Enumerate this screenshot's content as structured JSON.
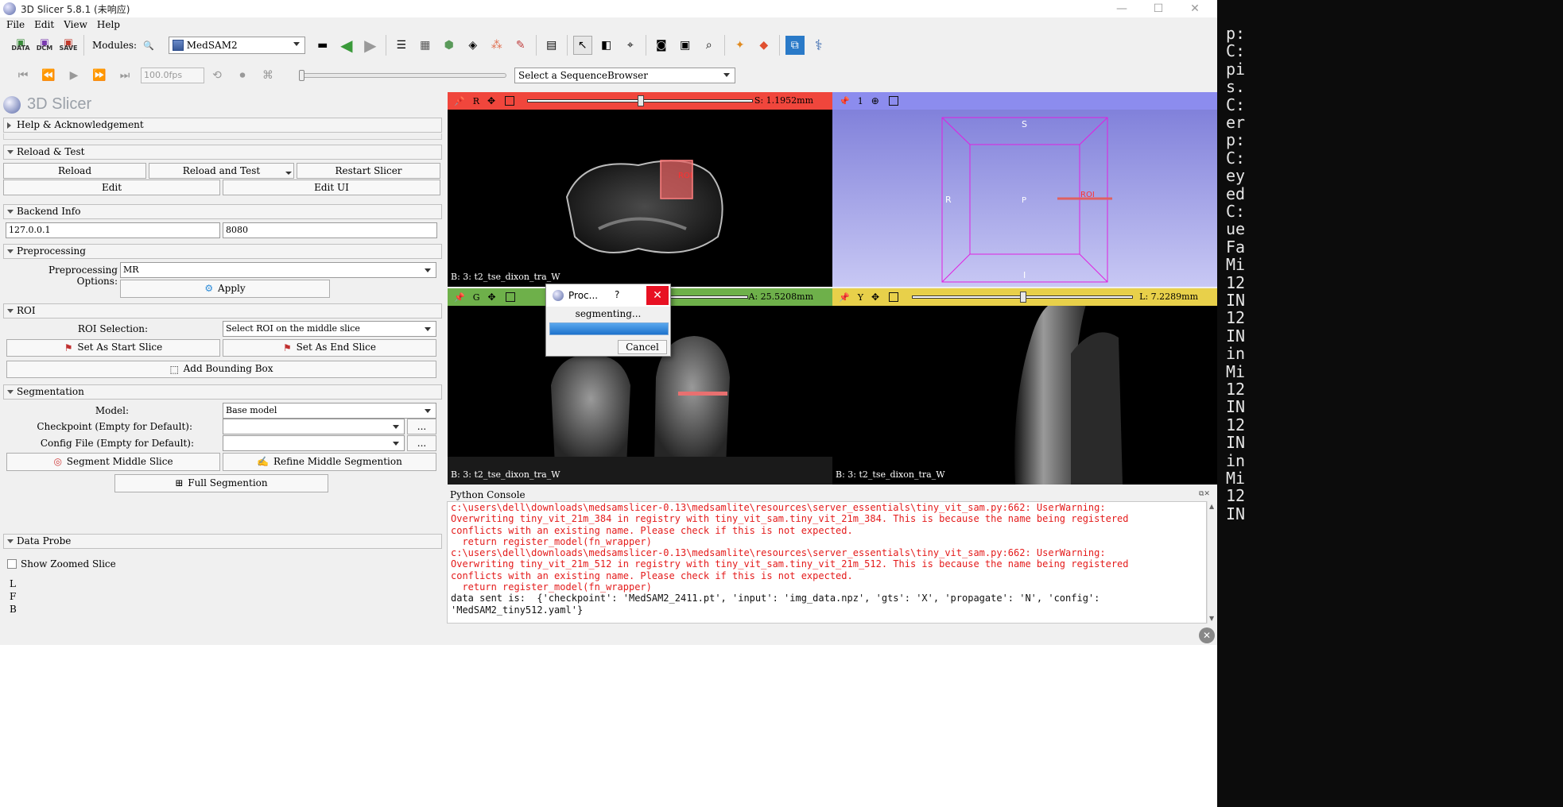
{
  "window": {
    "title": "3D Slicer 5.8.1 (未响应)"
  },
  "menu": [
    "File",
    "Edit",
    "View",
    "Help"
  ],
  "toolbar": {
    "data_label": "DATA",
    "dcm_label": "DCM",
    "save_label": "SAVE",
    "modules_label": "Modules:",
    "module_selected": "MedSAM2"
  },
  "playback": {
    "fps": "100.0fps",
    "sequence_browser": "Select a SequenceBrowser"
  },
  "left_panel": {
    "logo_text": "3D Slicer",
    "help_header": "Help & Acknowledgement",
    "reload_header": "Reload & Test",
    "reload_btn": "Reload",
    "reload_test_btn": "Reload and Test",
    "restart_btn": "Restart Slicer",
    "edit_btn": "Edit",
    "edit_ui_btn": "Edit UI",
    "backend_header": "Backend Info",
    "backend_host": "127.0.0.1",
    "backend_port": "8080",
    "preprocessing_header": "Preprocessing",
    "preprocessing_label": "Preprocessing Options:",
    "preprocessing_value": "MR",
    "apply_btn": "Apply",
    "roi_header": "ROI",
    "roi_selection_label": "ROI Selection:",
    "roi_selection_value": "Select ROI on the middle slice",
    "start_slice_btn": "Set As Start Slice",
    "end_slice_btn": "Set As End Slice",
    "bbox_btn": "Add Bounding Box",
    "segmentation_header": "Segmentation",
    "model_label": "Model:",
    "model_value": "Base model",
    "checkpoint_label": "Checkpoint (Empty for Default):",
    "config_label": "Config File (Empty for Default):",
    "browse": "...",
    "segment_middle_btn": "Segment Middle Slice",
    "refine_middle_btn": "Refine Middle Segmention",
    "full_seg_btn": "Full Segmention",
    "data_probe_header": "Data Probe",
    "show_zoomed": "Show Zoomed Slice",
    "probe_L": "L",
    "probe_F": "F",
    "probe_B": "B"
  },
  "views": {
    "red": {
      "letter": "R",
      "value": "S: 1.1952mm",
      "caption": "B: 3: t2_tse_dixon_tra_W",
      "color": "#f0463c",
      "slider_fraction": 0.5
    },
    "threed": {
      "letter": "1",
      "S": "S",
      "R": "R",
      "P": "P",
      "I": "I",
      "color": "#8c8cee"
    },
    "green": {
      "letter": "G",
      "value": "A: 25.5208mm",
      "caption": "B: 3: t2_tse_dixon_tra_W",
      "color": "#6eb04a"
    },
    "yellow": {
      "letter": "Y",
      "value": "L: 7.2289mm",
      "caption": "B: 3: t2_tse_dixon_tra_W",
      "color": "#e8d04a",
      "slider_fraction": 0.5
    },
    "roi_label": "ROI"
  },
  "console": {
    "title": "Python Console",
    "lines": [
      {
        "t": "c:\\users\\dell\\downloads\\medsamslicer-0.13\\medsamlite\\resources\\server_essentials\\tiny_vit_sam.py:662: UserWarning:",
        "c": "red"
      },
      {
        "t": "Overwriting tiny_vit_21m_384 in registry with tiny_vit_sam.tiny_vit_21m_384. This is because the name being registered",
        "c": "red"
      },
      {
        "t": "conflicts with an existing name. Please check if this is not expected.",
        "c": "red"
      },
      {
        "t": "  return register_model(fn_wrapper)",
        "c": "red"
      },
      {
        "t": "c:\\users\\dell\\downloads\\medsamslicer-0.13\\medsamlite\\resources\\server_essentials\\tiny_vit_sam.py:662: UserWarning:",
        "c": "red"
      },
      {
        "t": "Overwriting tiny_vit_21m_512 in registry with tiny_vit_sam.tiny_vit_21m_512. This is because the name being registered",
        "c": "red"
      },
      {
        "t": "conflicts with an existing name. Please check if this is not expected.",
        "c": "red"
      },
      {
        "t": "  return register_model(fn_wrapper)",
        "c": "red"
      },
      {
        "t": "data sent is:  {'checkpoint': 'MedSAM2_2411.pt', 'input': 'img_data.npz', 'gts': 'X', 'propagate': 'N', 'config':",
        "c": "black"
      },
      {
        "t": "'MedSAM2_tiny512.yaml'}",
        "c": "black"
      }
    ]
  },
  "dialog": {
    "title": "Proc...",
    "help": "?",
    "close": "✕",
    "message": "segmenting...",
    "progress": 1.0,
    "cancel": "Cancel"
  },
  "terminal": {
    "lines": [
      "p:",
      "C:",
      "pi",
      "s.",
      "C:",
      "er",
      "p:",
      "C:",
      "ey",
      "ed",
      "C:",
      "ue",
      "Fa",
      "Mi",
      "12",
      "IN",
      "12",
      "IN",
      "in",
      "Mi",
      "12",
      "IN",
      "12",
      "IN",
      "in",
      "Mi",
      "12",
      "IN"
    ]
  }
}
